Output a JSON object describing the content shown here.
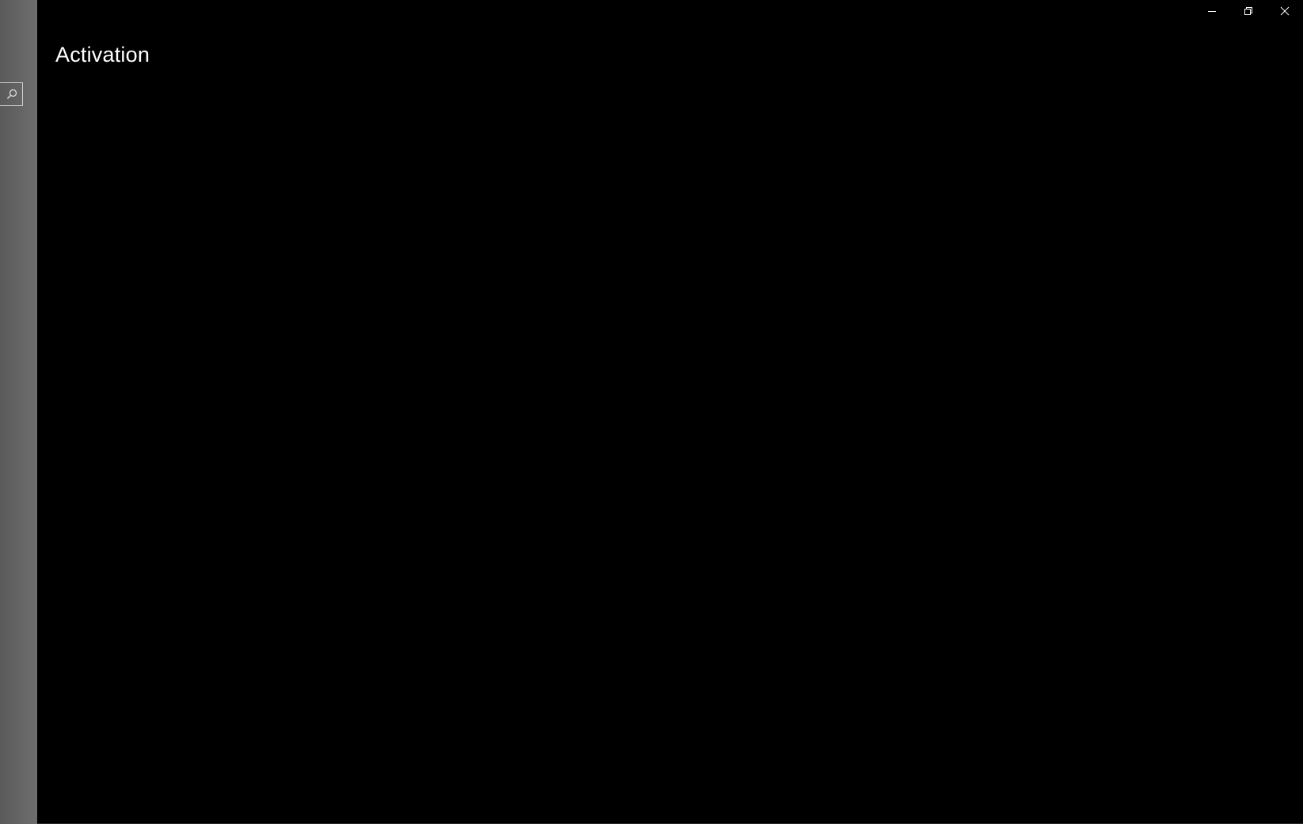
{
  "window": {
    "title": "Activation",
    "caption_buttons": {
      "minimize_icon": "minimize-icon",
      "restore_icon": "restore-icon",
      "close_icon": "close-icon"
    }
  },
  "sidebar": {
    "search": {
      "placeholder": "",
      "icon": "search-icon"
    }
  },
  "colors": {
    "background": "#000000",
    "sidebar": "#666666",
    "text": "#ffffff"
  }
}
